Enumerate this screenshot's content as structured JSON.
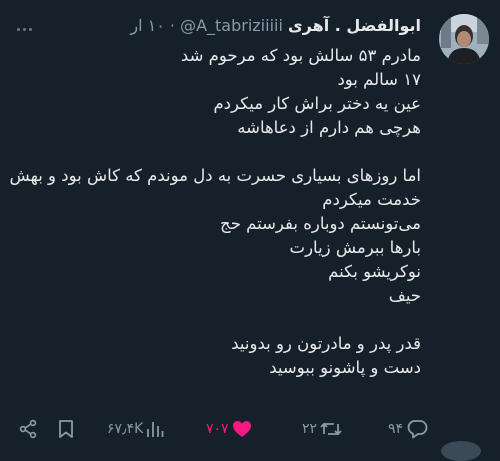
{
  "tweet": {
    "display_name": "ابوالفضل . آهری",
    "handle": "@A_tabriziiiii",
    "separator": "·",
    "time": "۱۰ ار",
    "lines": [
      "مادرم ۵۳ سالش بود که مرحوم شد",
      "۱۷ سالم بود",
      "عین یه دختر براش کار میکردم",
      "هرچی هم دارم از دعاهاشه",
      "",
      "اما روزهای بسیاری حسرت به دل موندم که کاش بود و بهش",
      "خدمت میکردم",
      "می‌تونستم دوباره بفرستم حج",
      "بارها ببرمش زیارت",
      "نوکریشو بکنم",
      "حیف",
      "",
      "قدر پدر و مادرتون رو بدونید",
      "دست و پاشونو ببوسید"
    ]
  },
  "actions": {
    "views": "۶۷٫۴K",
    "likes": "۷۰۷",
    "retweets": "۲۲",
    "replies": "۹۴"
  },
  "colors": {
    "background": "#15202b",
    "text": "#e7e9ea",
    "secondary": "#8b98a5",
    "like": "#f91880"
  }
}
